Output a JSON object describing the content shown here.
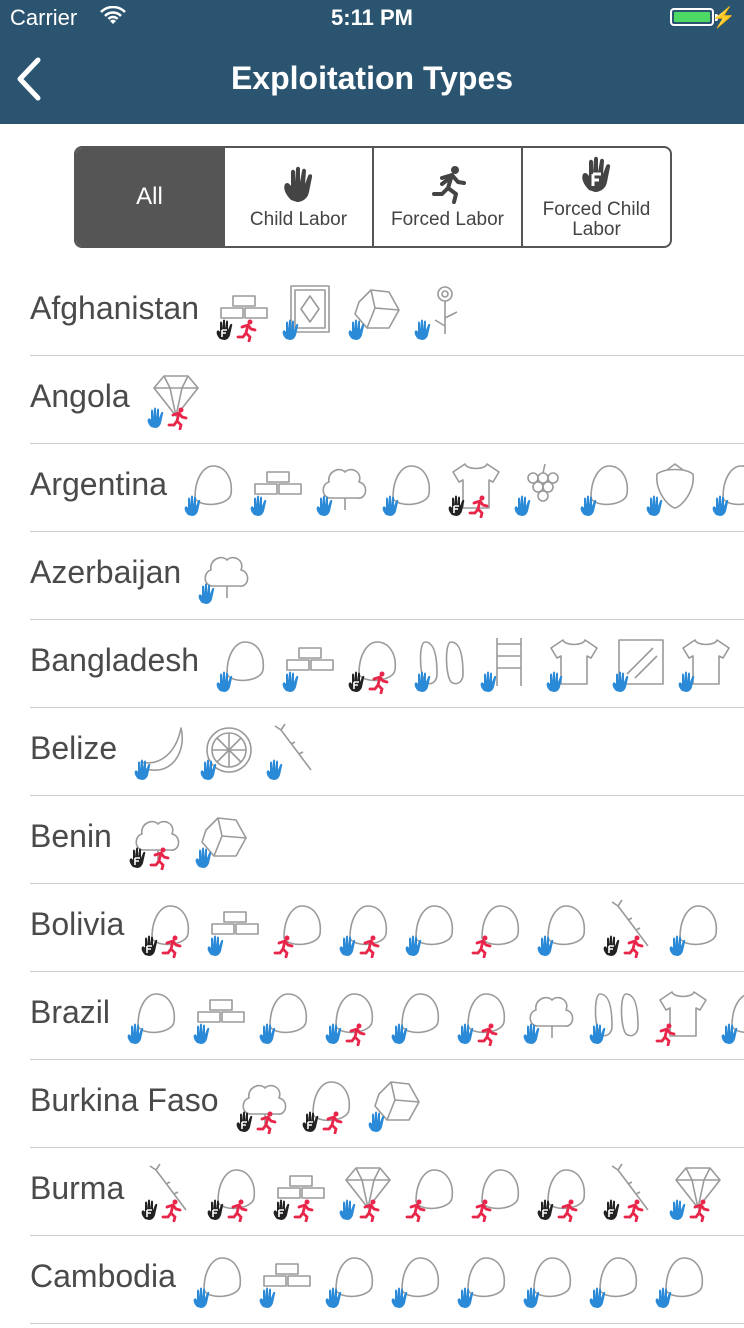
{
  "status_bar": {
    "carrier": "Carrier",
    "time": "5:11 PM"
  },
  "nav": {
    "title": "Exploitation Types"
  },
  "filters": {
    "all": "All",
    "child": "Child Labor",
    "forced": "Forced Labor",
    "forced_child": "Forced Child Labor"
  },
  "colors": {
    "navbar": "#2b5470",
    "child": "#2a8ad8",
    "forced": "#e8264a",
    "forced_child": "#222222",
    "active_segment": "#555555"
  },
  "countries": [
    {
      "name": "Afghanistan",
      "products": [
        [
          "bricks",
          "fc"
        ],
        [
          "carpets",
          "c"
        ],
        [
          "coal",
          "c"
        ],
        [
          "poppies",
          "c"
        ]
      ]
    },
    {
      "name": "Angola",
      "products": [
        [
          "diamonds",
          "cf"
        ]
      ]
    },
    {
      "name": "Argentina",
      "products": [
        [
          "blueberries",
          "c"
        ],
        [
          "bricks",
          "c"
        ],
        [
          "cotton",
          "c"
        ],
        [
          "garlic",
          "c"
        ],
        [
          "garments",
          "fc"
        ],
        [
          "grapes",
          "c"
        ],
        [
          "olives",
          "c"
        ],
        [
          "strawberries",
          "c"
        ],
        [
          "tobacco",
          "c"
        ]
      ]
    },
    {
      "name": "Azerbaijan",
      "products": [
        [
          "cotton",
          "c"
        ]
      ]
    },
    {
      "name": "Bangladesh",
      "products": [
        [
          "bidis",
          "c"
        ],
        [
          "bricks",
          "c"
        ],
        [
          "dried-fish",
          "fc"
        ],
        [
          "footwear",
          "c"
        ],
        [
          "furniture",
          "c"
        ],
        [
          "garments",
          "c"
        ],
        [
          "glass",
          "c"
        ],
        [
          "leather",
          "c"
        ]
      ]
    },
    {
      "name": "Belize",
      "products": [
        [
          "bananas",
          "c"
        ],
        [
          "citrus-fruits",
          "c"
        ],
        [
          "sugarcane",
          "c"
        ]
      ]
    },
    {
      "name": "Benin",
      "products": [
        [
          "cotton",
          "fc"
        ],
        [
          "granite",
          "c"
        ]
      ]
    },
    {
      "name": "Bolivia",
      "products": [
        [
          "brazil-nuts",
          "fc"
        ],
        [
          "bricks",
          "c"
        ],
        [
          "cattle",
          "f"
        ],
        [
          "corn",
          "cf"
        ],
        [
          "gold",
          "c"
        ],
        [
          "peanuts",
          "f"
        ],
        [
          "silver",
          "c"
        ],
        [
          "sugarcane",
          "fc"
        ],
        [
          "tin",
          "c"
        ]
      ]
    },
    {
      "name": "Brazil",
      "products": [
        [
          "beef",
          "c"
        ],
        [
          "bricks",
          "c"
        ],
        [
          "cashews",
          "c"
        ],
        [
          "cattle",
          "cf"
        ],
        [
          "ceramics",
          "c"
        ],
        [
          "charcoal",
          "cf"
        ],
        [
          "cotton",
          "c"
        ],
        [
          "footwear",
          "c"
        ],
        [
          "garments",
          "f"
        ],
        [
          "manioc",
          "c"
        ]
      ]
    },
    {
      "name": "Burkina Faso",
      "products": [
        [
          "cotton",
          "fc"
        ],
        [
          "gold",
          "fc"
        ],
        [
          "granite",
          "c"
        ]
      ]
    },
    {
      "name": "Burma",
      "products": [
        [
          "bamboo",
          "fc"
        ],
        [
          "beans",
          "fc"
        ],
        [
          "bricks",
          "fc"
        ],
        [
          "jade",
          "cf"
        ],
        [
          "rice",
          "f"
        ],
        [
          "peas",
          "f"
        ],
        [
          "rice-cooked",
          "fc"
        ],
        [
          "sugarcane",
          "fc"
        ],
        [
          "rubies",
          "cf"
        ]
      ]
    },
    {
      "name": "Cambodia",
      "products": [
        [
          "alcoholic-beverages",
          "c"
        ],
        [
          "bricks",
          "c"
        ],
        [
          "fish",
          "c"
        ],
        [
          "shrimp",
          "c"
        ],
        [
          "meat",
          "c"
        ],
        [
          "rubber",
          "c"
        ],
        [
          "salt",
          "c"
        ],
        [
          "shellfish",
          "c"
        ]
      ]
    }
  ]
}
